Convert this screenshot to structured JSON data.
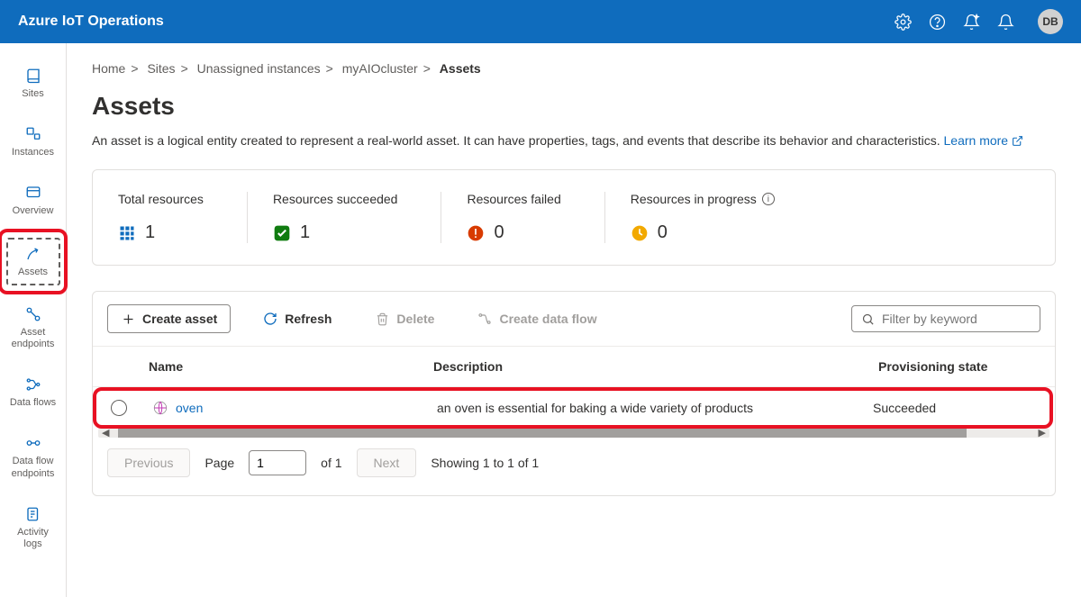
{
  "header": {
    "title": "Azure IoT Operations",
    "avatar": "DB"
  },
  "sidebar": {
    "items": [
      {
        "label": "Sites"
      },
      {
        "label": "Instances"
      },
      {
        "label": "Overview"
      },
      {
        "label": "Assets"
      },
      {
        "label": "Asset endpoints"
      },
      {
        "label": "Data flows"
      },
      {
        "label": "Data flow endpoints"
      },
      {
        "label": "Activity logs"
      }
    ]
  },
  "breadcrumbs": {
    "items": [
      "Home",
      "Sites",
      "Unassigned instances",
      "myAIOcluster"
    ],
    "current": "Assets"
  },
  "page": {
    "title": "Assets",
    "description": "An asset is a logical entity created to represent a real-world asset. It can have properties, tags, and events that describe its behavior and characteristics.",
    "learn_more": "Learn more"
  },
  "stats": {
    "total": {
      "label": "Total resources",
      "value": "1"
    },
    "succeeded": {
      "label": "Resources succeeded",
      "value": "1"
    },
    "failed": {
      "label": "Resources failed",
      "value": "0"
    },
    "progress": {
      "label": "Resources in progress",
      "value": "0"
    }
  },
  "toolbar": {
    "create": "Create asset",
    "refresh": "Refresh",
    "delete": "Delete",
    "dataflow": "Create data flow",
    "filter_placeholder": "Filter by keyword"
  },
  "table": {
    "headers": {
      "name": "Name",
      "description": "Description",
      "provisioning": "Provisioning state"
    },
    "rows": [
      {
        "name": "oven",
        "description": "an oven is essential for baking a wide variety of products",
        "provisioning": "Succeeded"
      }
    ]
  },
  "pager": {
    "previous": "Previous",
    "page_label": "Page",
    "current_page": "1",
    "of": "of 1",
    "next": "Next",
    "showing": "Showing 1 to 1 of 1"
  }
}
